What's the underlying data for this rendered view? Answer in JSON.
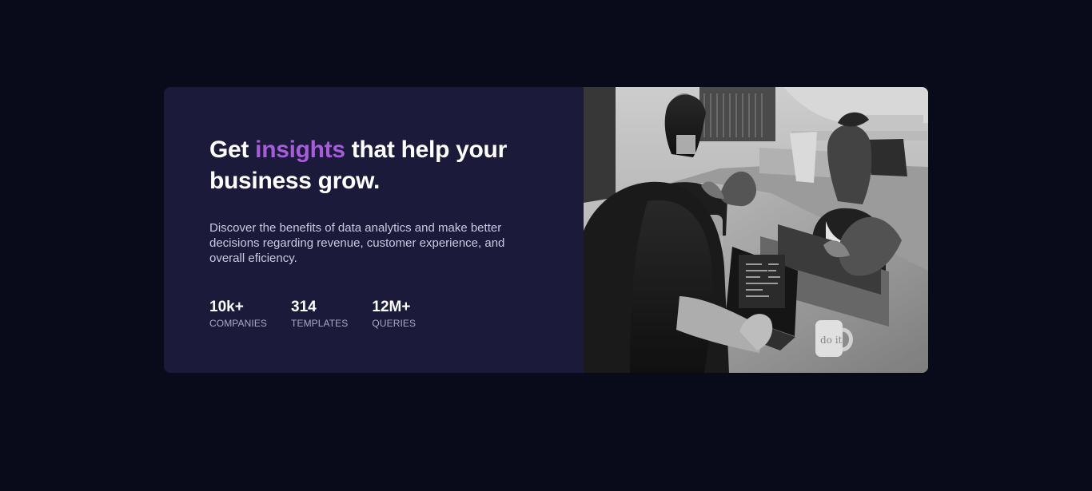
{
  "hero": {
    "title": {
      "before": "Get ",
      "accent": "insights",
      "after": " that help your business grow."
    },
    "description": "Discover the benefits of data analytics and make better decisions regarding revenue, customer experience, and overall eficiency.",
    "stats": [
      {
        "value": "10k+",
        "label": "COMPANIES"
      },
      {
        "value": "314",
        "label": "TEMPLATES"
      },
      {
        "value": "12M+",
        "label": "QUERIES"
      }
    ]
  },
  "colors": {
    "page_background": "#090b1b",
    "card_background": "#1c1a3b",
    "accent": "#a75cd9",
    "heading": "#ffffff",
    "body_text": "#c9c9e0",
    "stat_label": "#a9a9c3"
  }
}
